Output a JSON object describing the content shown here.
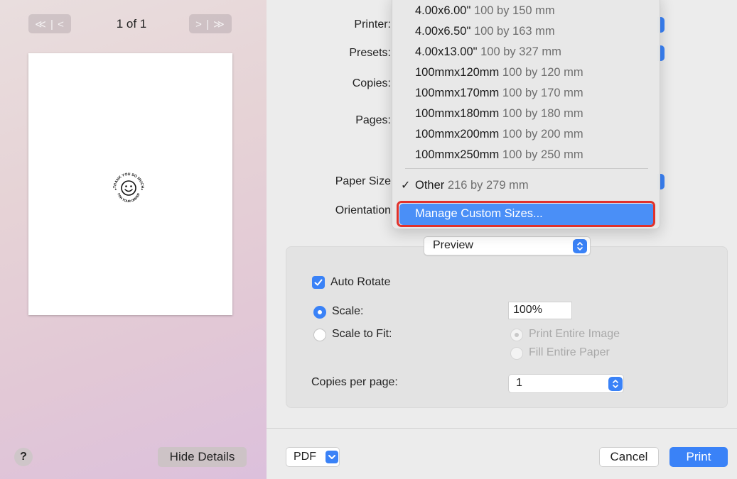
{
  "left_pane": {
    "page_count": "1 of 1",
    "first_prev_label": "≪ | <",
    "next_last_label": "> | ≫",
    "help_label": "?",
    "hide_details_label": "Hide Details"
  },
  "form": {
    "printer_label": "Printer:",
    "presets_label": "Presets:",
    "copies_label": "Copies:",
    "pages_label": "Pages:",
    "paper_size_label": "Paper Size",
    "orientation_label": "Orientation"
  },
  "paper_menu": {
    "items": [
      {
        "name": "4.00x6.00\"",
        "dims": "100 by 150 mm"
      },
      {
        "name": "4.00x6.50\"",
        "dims": "100 by 163 mm"
      },
      {
        "name": "4.00x13.00\"",
        "dims": "100 by 327 mm"
      },
      {
        "name": "100mmx120mm",
        "dims": "100 by 120 mm"
      },
      {
        "name": "100mmx170mm",
        "dims": "100 by 170 mm"
      },
      {
        "name": "100mmx180mm",
        "dims": "100 by 180 mm"
      },
      {
        "name": "100mmx200mm",
        "dims": "100 by 200 mm"
      },
      {
        "name": "100mmx250mm",
        "dims": "100 by 250 mm"
      }
    ],
    "selected": {
      "name": "Other",
      "dims": "216 by 279 mm",
      "check": "✓"
    },
    "manage_label": "Manage Custom Sizes..."
  },
  "section": {
    "select_value": "Preview",
    "auto_rotate_label": "Auto Rotate",
    "auto_rotate_checked": true,
    "scale_label": "Scale:",
    "scale_value": "100%",
    "scale_to_fit_label": "Scale to Fit:",
    "print_entire_image_label": "Print Entire Image",
    "fill_entire_paper_label": "Fill Entire Paper",
    "copies_per_page_label": "Copies per page:",
    "copies_per_page_value": "1"
  },
  "footer": {
    "pdf_label": "PDF",
    "cancel_label": "Cancel",
    "print_label": "Print"
  },
  "colors": {
    "accent": "#3a82f7",
    "highlight_border": "#e0322c",
    "menu_selection": "#4a8ff7"
  },
  "sticker": {
    "top_text": "THANK YOU SO MUCH",
    "bottom_text": "FOR YOUR ORDER"
  }
}
